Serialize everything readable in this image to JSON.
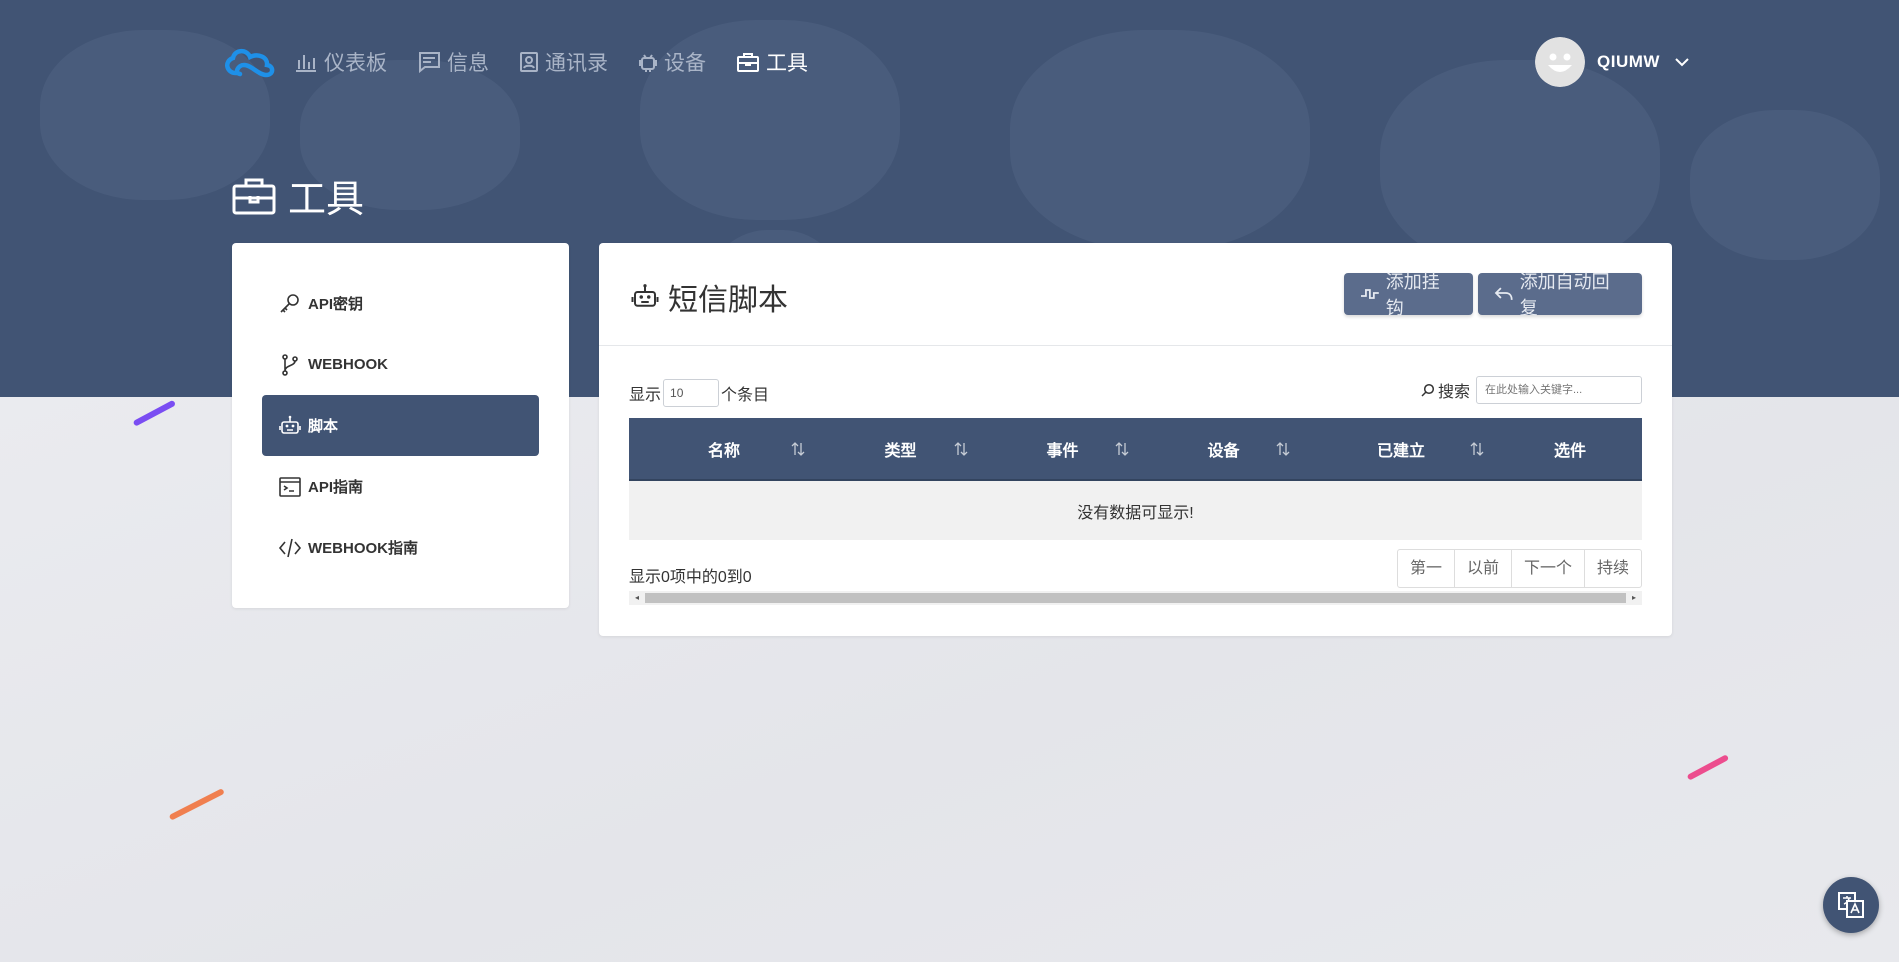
{
  "nav": {
    "items": [
      {
        "label": "仪表板",
        "icon": "bar-chart-icon",
        "active": false
      },
      {
        "label": "信息",
        "icon": "message-icon",
        "active": false
      },
      {
        "label": "通讯录",
        "icon": "contacts-icon",
        "active": false
      },
      {
        "label": "设备",
        "icon": "android-icon",
        "active": false
      },
      {
        "label": "工具",
        "icon": "toolbox-icon",
        "active": true
      }
    ],
    "user": {
      "name": "QIUMW"
    }
  },
  "page": {
    "title": "工具"
  },
  "sidebar": {
    "items": [
      {
        "label": "API密钥",
        "icon": "key-icon",
        "active": false
      },
      {
        "label": "WEBHOOK",
        "icon": "git-branch-icon",
        "active": false
      },
      {
        "label": "脚本",
        "icon": "robot-icon",
        "active": true
      },
      {
        "label": "API指南",
        "icon": "terminal-icon",
        "active": false
      },
      {
        "label": "WEBHOOK指南",
        "icon": "code-icon",
        "active": false
      }
    ]
  },
  "panel": {
    "title": "短信脚本",
    "buttons": {
      "add_hook": "添加挂钩",
      "add_reply": "添加自动回复"
    },
    "length": {
      "prefix": "显示",
      "value": "10",
      "suffix": "个条目"
    },
    "search": {
      "label": "搜索",
      "placeholder": "在此处输入关键字..."
    },
    "table": {
      "columns": [
        "名称",
        "类型",
        "事件",
        "设备",
        "已建立",
        "选件"
      ],
      "empty": "没有数据可显示!"
    },
    "info": "显示0项中的0到0",
    "pager": [
      "第一",
      "以前",
      "下一个",
      "持续"
    ]
  },
  "colors": {
    "primary": "#415474",
    "button": "#5b6c8c",
    "background": "#e7e8ec",
    "accent": "#1e90e8"
  }
}
